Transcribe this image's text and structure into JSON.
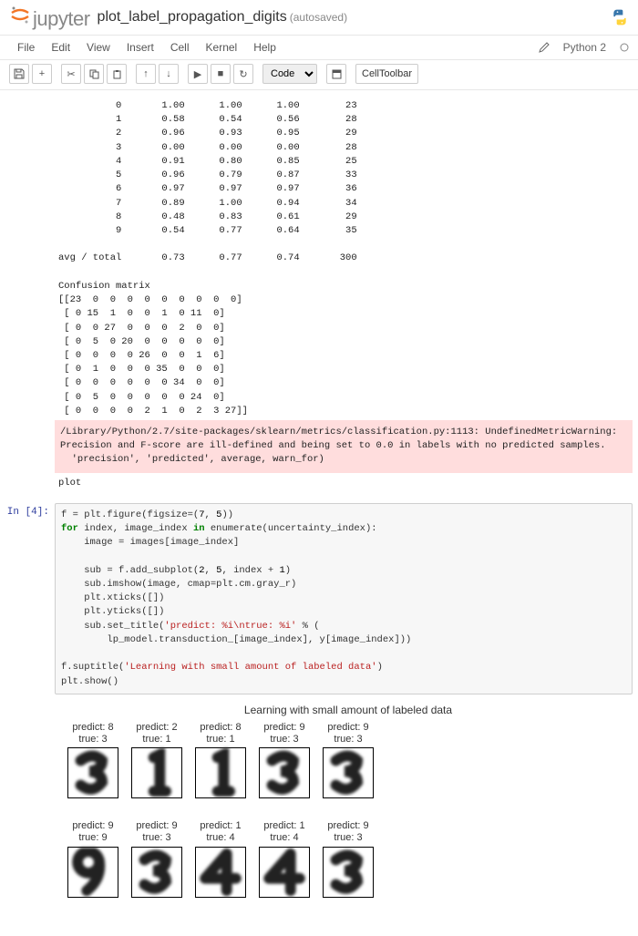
{
  "header": {
    "logo_text": "jupyter",
    "title": "plot_label_propagation_digits",
    "autosave": "(autosaved)"
  },
  "menubar": {
    "items": [
      "File",
      "Edit",
      "View",
      "Insert",
      "Cell",
      "Kernel",
      "Help"
    ],
    "kernel": "Python 2"
  },
  "toolbar": {
    "cell_type": "Code",
    "celltoolbar": "CellToolbar"
  },
  "output": {
    "table": "          0       1.00      1.00      1.00        23\n          1       0.58      0.54      0.56        28\n          2       0.96      0.93      0.95        29\n          3       0.00      0.00      0.00        28\n          4       0.91      0.80      0.85        25\n          5       0.96      0.79      0.87        33\n          6       0.97      0.97      0.97        36\n          7       0.89      1.00      0.94        34\n          8       0.48      0.83      0.61        29\n          9       0.54      0.77      0.64        35\n\navg / total       0.73      0.77      0.74       300\n\nConfusion matrix\n[[23  0  0  0  0  0  0  0  0  0]\n [ 0 15  1  0  0  1  0 11  0]\n [ 0  0 27  0  0  0  2  0  0]\n [ 0  5  0 20  0  0  0  0  0]\n [ 0  0  0  0 26  0  0  1  6]\n [ 0  1  0  0  0 35  0  0  0]\n [ 0  0  0  0  0  0 34  0  0]\n [ 0  5  0  0  0  0  0 24  0]\n [ 0  0  0  0  2  1  0  2  3 27]]",
    "warning": "/Library/Python/2.7/site-packages/sklearn/metrics/classification.py:1113: UndefinedMetricWarning: Precision and F-score are ill-defined and being set to 0.0 in labels with no predicted samples.\n  'precision', 'predicted', average, warn_for)",
    "plot_label": "plot"
  },
  "code": {
    "prompt": "In [4]:",
    "lines": [
      {
        "t": [
          "f = plt.figure(figsize=(",
          {
            "n": "7"
          },
          ", ",
          {
            "n": "5"
          },
          "))"
        ]
      },
      {
        "t": [
          {
            "k": "for"
          },
          " index, image_index ",
          {
            "k": "in"
          },
          " enumerate(uncertainty_index):"
        ]
      },
      {
        "t": [
          "    image = images[image_index]"
        ]
      },
      {
        "t": [
          ""
        ]
      },
      {
        "t": [
          "    sub = f.add_subplot(",
          {
            "n": "2"
          },
          ", ",
          {
            "n": "5"
          },
          ", index + ",
          {
            "n": "1"
          },
          ")"
        ]
      },
      {
        "t": [
          "    sub.imshow(image, cmap=plt.cm.gray_r)"
        ]
      },
      {
        "t": [
          "    plt.xticks([])"
        ]
      },
      {
        "t": [
          "    plt.yticks([])"
        ]
      },
      {
        "t": [
          "    sub.set_title(",
          {
            "s": "'predict: %i\\ntrue: %i'"
          },
          " % ("
        ]
      },
      {
        "t": [
          "        lp_model.transduction_[image_index], y[image_index]))"
        ]
      },
      {
        "t": [
          ""
        ]
      },
      {
        "t": [
          "f.suptitle(",
          {
            "s": "'Learning with small amount of labeled data'"
          },
          ")"
        ]
      },
      {
        "t": [
          "plt.show()"
        ]
      }
    ]
  },
  "figure": {
    "title": "Learning with small amount of labeled data",
    "subs": [
      {
        "predict": 8,
        "true": 3,
        "glyph": 3
      },
      {
        "predict": 2,
        "true": 1,
        "glyph": 1
      },
      {
        "predict": 8,
        "true": 1,
        "glyph": 1
      },
      {
        "predict": 9,
        "true": 3,
        "glyph": 3
      },
      {
        "predict": 9,
        "true": 3,
        "glyph": 3
      },
      {
        "predict": 9,
        "true": 9,
        "glyph": 9
      },
      {
        "predict": 9,
        "true": 3,
        "glyph": 3
      },
      {
        "predict": 1,
        "true": 4,
        "glyph": 4
      },
      {
        "predict": 1,
        "true": 4,
        "glyph": 4
      },
      {
        "predict": 9,
        "true": 3,
        "glyph": 3
      }
    ]
  }
}
